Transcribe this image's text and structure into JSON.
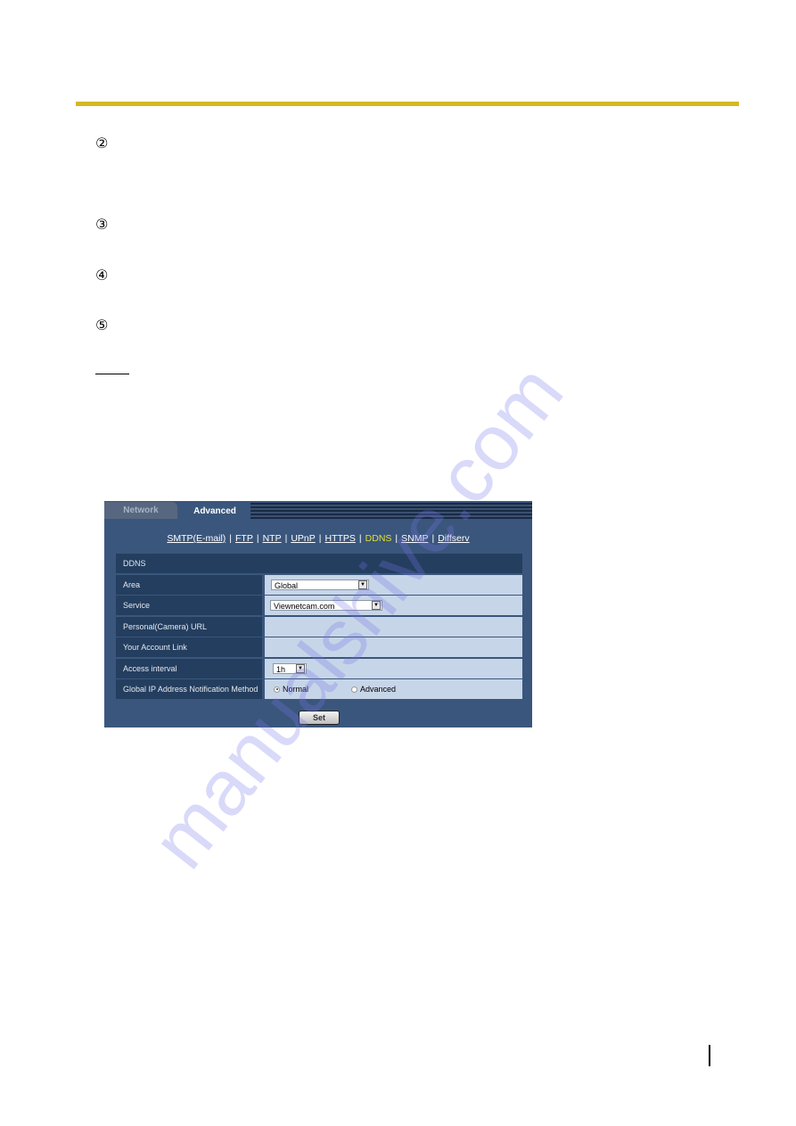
{
  "document": {
    "markers": [
      "②",
      "③",
      "④",
      "⑤"
    ],
    "watermark": "manualshive.com"
  },
  "panel": {
    "tabs": [
      {
        "label": "Network",
        "active": false
      },
      {
        "label": "Advanced",
        "active": true
      }
    ],
    "subnav": [
      {
        "label": "SMTP(E-mail)",
        "active": false
      },
      {
        "label": "FTP",
        "active": false
      },
      {
        "label": "NTP",
        "active": false
      },
      {
        "label": "UPnP",
        "active": false
      },
      {
        "label": "HTTPS",
        "active": false
      },
      {
        "label": "DDNS",
        "active": true
      },
      {
        "label": "SNMP",
        "active": false
      },
      {
        "label": "Diffserv",
        "active": false
      }
    ],
    "section_title": "DDNS",
    "rows": {
      "area": {
        "label": "Area",
        "value": "Global"
      },
      "service": {
        "label": "Service",
        "value": "Viewnetcam.com"
      },
      "personal_url": {
        "label": "Personal(Camera) URL",
        "value": ""
      },
      "account_link": {
        "label": "Your Account Link",
        "value": ""
      },
      "access_interval": {
        "label": "Access interval",
        "value": "1h"
      },
      "notification": {
        "label": "Global IP Address Notification Method",
        "options": [
          "Normal",
          "Advanced"
        ],
        "selected": "Normal"
      }
    },
    "set_label": "Set"
  },
  "colors": {
    "accent_bar": "#d4b823",
    "panel_bg": "#3a567c",
    "label_bg": "#243e5f",
    "value_bg": "#c7d5e8",
    "active_link": "#e6e02a"
  }
}
